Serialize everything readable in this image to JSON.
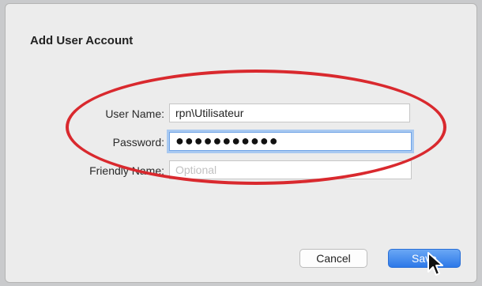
{
  "dialog": {
    "title": "Add User Account",
    "username_label": "User Name:",
    "username_value": "rpn\\Utilisateur",
    "password_label": "Password:",
    "password_masked": "●●●●●●●●●●●",
    "friendly_label": "Friendly Name:",
    "friendly_placeholder": "Optional",
    "cancel_label": "Cancel",
    "save_label": "Save"
  },
  "colors": {
    "accent": "#2d79e8",
    "highlight_oval": "#d9292e",
    "focus_ring": "#a8c9f1"
  },
  "icons": {
    "cursor": "arrow-pointer-icon"
  }
}
